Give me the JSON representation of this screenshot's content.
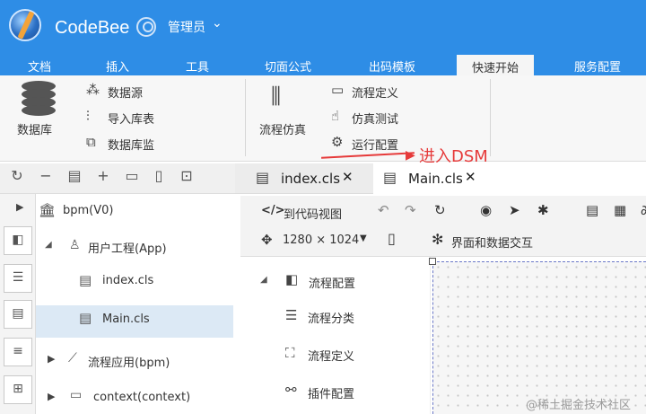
{
  "app": {
    "title": "CodeBee",
    "user": "管理员"
  },
  "tabs": [
    "文档",
    "插入",
    "工具",
    "切面公式",
    "出码模板",
    "快速开始",
    "服务配置"
  ],
  "ribbon": {
    "db_label": "数据库",
    "items_col1": [
      "数据源",
      "导入库表",
      "数据库监"
    ],
    "flow_sim": "流程仿真",
    "items_col2": [
      "流程定义",
      "仿真测试",
      "运行配置"
    ]
  },
  "annotation": {
    "dsm": "进入DSM"
  },
  "tree": {
    "root": "bpm(V0)",
    "user_project": "用户工程(App)",
    "file1": "index.cls",
    "file2": "Main.cls",
    "flow_app": "流程应用(bpm)",
    "context": "context(context)"
  },
  "editor_tabs": [
    "index.cls",
    "Main.cls"
  ],
  "designer": {
    "to_code": "到代码视图",
    "resolution": "1280 × 1024",
    "ui_data": "界面和数据交互"
  },
  "outline": {
    "flow_config": "流程配置",
    "flow_category": "流程分类",
    "flow_def": "流程定义",
    "plugin_config": "插件配置"
  },
  "watermark": "@稀土掘金技术社区",
  "colors": {
    "accent": "#2e8de6",
    "annotation": "#e63a3a",
    "selected": "#dce9f5"
  }
}
